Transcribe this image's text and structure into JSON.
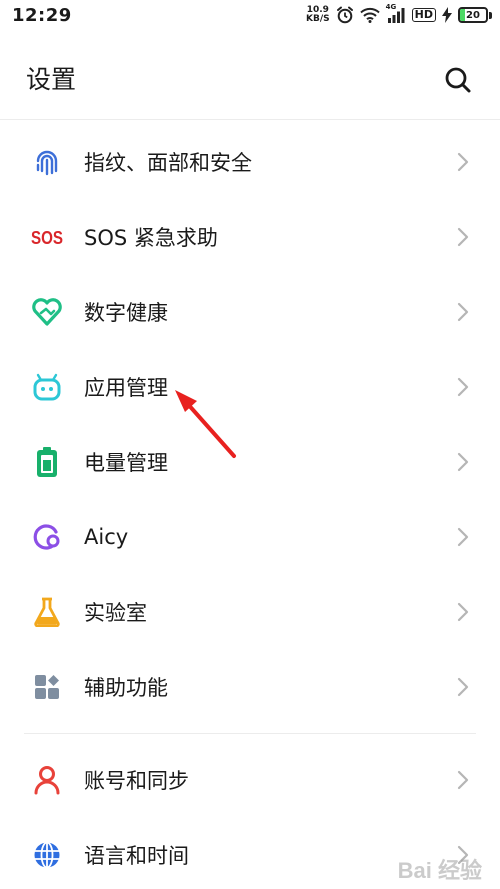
{
  "status_bar": {
    "time": "12:29",
    "net_speed_value": "10.9",
    "net_speed_unit": "KB/S",
    "network_type": "4G",
    "hd_label": "HD",
    "battery_level": "20",
    "battery_percent": 20
  },
  "header": {
    "title": "设置",
    "search_icon": "search-icon"
  },
  "settings_items": [
    {
      "label": "指纹、面部和安全",
      "icon": "fingerprint-icon",
      "color": "#3d6fd8"
    },
    {
      "label": "SOS 紧急求助",
      "icon": "sos-icon",
      "color": "#d9262a"
    },
    {
      "label": "数字健康",
      "icon": "digital-health-icon",
      "color": "#1fbf86"
    },
    {
      "label": "应用管理",
      "icon": "app-management-icon",
      "color": "#2cc7d6"
    },
    {
      "label": "电量管理",
      "icon": "battery-management-icon",
      "color": "#18b06b"
    },
    {
      "label": "Aicy",
      "icon": "aicy-icon",
      "color": "#8c4fe6"
    },
    {
      "label": "实验室",
      "icon": "lab-flask-icon",
      "color": "#f2a81d"
    },
    {
      "label": "辅助功能",
      "icon": "accessibility-icon",
      "color": "#7f8ea0"
    },
    {
      "label": "账号和同步",
      "icon": "account-icon",
      "color": "#e8423a"
    },
    {
      "label": "语言和时间",
      "icon": "globe-icon",
      "color": "#2f6ee0"
    }
  ],
  "annotation": {
    "arrow_color": "#e8211f"
  },
  "watermark": {
    "text": "Bai 经验"
  }
}
